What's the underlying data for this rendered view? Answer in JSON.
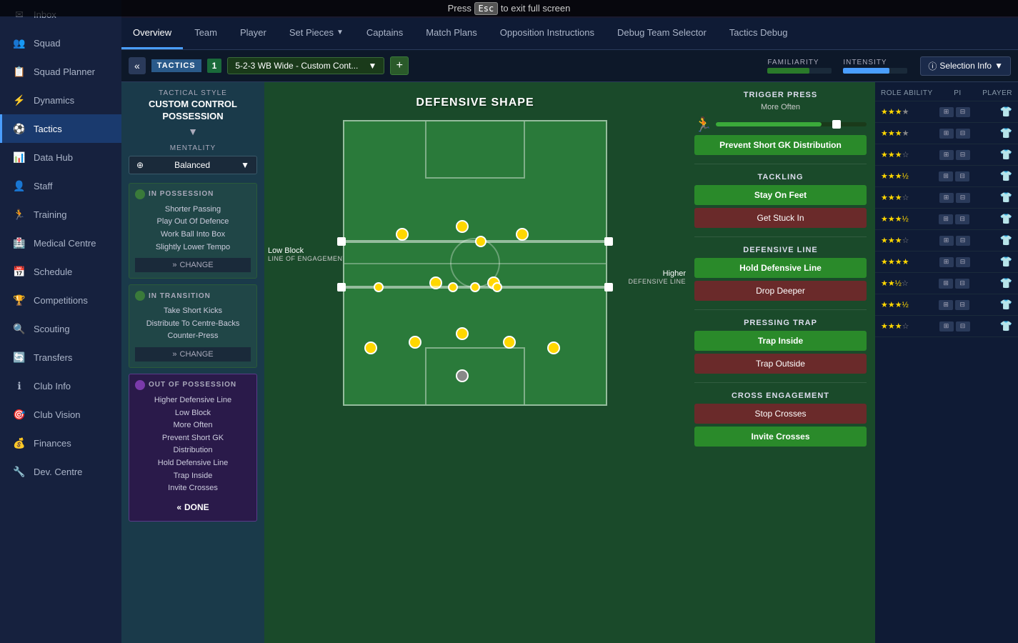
{
  "esc_bar": {
    "text_before": "Press",
    "key": "Esc",
    "text_after": "to exit full screen"
  },
  "sidebar": {
    "items": [
      {
        "id": "inbox",
        "label": "Inbox",
        "icon": "✉"
      },
      {
        "id": "squad",
        "label": "Squad",
        "icon": "👥"
      },
      {
        "id": "squad-planner",
        "label": "Squad Planner",
        "icon": "📋"
      },
      {
        "id": "dynamics",
        "label": "Dynamics",
        "icon": "⚡"
      },
      {
        "id": "tactics",
        "label": "Tactics",
        "icon": "⚽"
      },
      {
        "id": "data-hub",
        "label": "Data Hub",
        "icon": "📊"
      },
      {
        "id": "staff",
        "label": "Staff",
        "icon": "👤"
      },
      {
        "id": "training",
        "label": "Training",
        "icon": "🏃"
      },
      {
        "id": "medical",
        "label": "Medical Centre",
        "icon": "🏥"
      },
      {
        "id": "schedule",
        "label": "Schedule",
        "icon": "📅"
      },
      {
        "id": "competitions",
        "label": "Competitions",
        "icon": "🏆"
      },
      {
        "id": "scouting",
        "label": "Scouting",
        "icon": "🔍"
      },
      {
        "id": "transfers",
        "label": "Transfers",
        "icon": "🔄"
      },
      {
        "id": "club-info",
        "label": "Club Info",
        "icon": "ℹ"
      },
      {
        "id": "club-vision",
        "label": "Club Vision",
        "icon": "🎯"
      },
      {
        "id": "finances",
        "label": "Finances",
        "icon": "💰"
      },
      {
        "id": "dev-centre",
        "label": "Dev. Centre",
        "icon": "🔧"
      }
    ]
  },
  "top_nav": {
    "items": [
      {
        "id": "overview",
        "label": "Overview",
        "active": true
      },
      {
        "id": "team",
        "label": "Team",
        "active": false
      },
      {
        "id": "player",
        "label": "Player",
        "active": false
      },
      {
        "id": "set-pieces",
        "label": "Set Pieces",
        "has_dropdown": true,
        "active": false
      },
      {
        "id": "captains",
        "label": "Captains",
        "active": false
      },
      {
        "id": "match-plans",
        "label": "Match Plans",
        "active": false
      },
      {
        "id": "opp-instructions",
        "label": "Opposition Instructions",
        "active": false
      },
      {
        "id": "debug-team",
        "label": "Debug Team Selector",
        "active": false
      },
      {
        "id": "tactics-debug",
        "label": "Tactics Debug",
        "active": false
      }
    ]
  },
  "tactics_bar": {
    "tactics_label": "TACTICS",
    "tactic_num": "1",
    "formation": "5-2-3 WB Wide - Custom Cont...",
    "familiarity_label": "FAMILIARITY",
    "intensity_label": "INTENSITY",
    "familiarity_pct": 65,
    "intensity_pct": 72,
    "selection_info_label": "Selection Info"
  },
  "left_panel": {
    "tactical_style_label": "TACTICAL STYLE",
    "tactical_style_value": "CUSTOM CONTROL\nPOSSESSION",
    "mentality_label": "MENTALITY",
    "mentality_value": "Balanced",
    "in_possession_label": "IN POSSESSION",
    "in_possession_items": [
      "Shorter Passing",
      "Play Out Of Defence",
      "Work Ball Into Box",
      "Slightly Lower Tempo"
    ],
    "change_label": "CHANGE",
    "in_transition_label": "IN TRANSITION",
    "in_transition_items": [
      "Take Short Kicks",
      "Distribute To Centre-Backs",
      "Counter-Press"
    ],
    "out_of_possession_label": "OUT OF POSSESSION",
    "out_of_possession_items": [
      "Higher Defensive Line",
      "Low Block",
      "More Often",
      "Prevent Short GK Distribution",
      "Hold Defensive Line",
      "Trap Inside",
      "Invite Crosses"
    ],
    "done_label": "DONE"
  },
  "center_pitch": {
    "title": "DEFENSIVE SHAPE",
    "low_block_label": "Low Block",
    "line_of_engagement": "LINE OF ENGAGEMENT",
    "higher_defensive_line": "Higher\nDEFENSIVE LINE"
  },
  "right_panel": {
    "trigger_press_label": "TRIGGER PRESS",
    "trigger_more_often": "More Often",
    "prevent_short_gk": "Prevent Short GK Distribution",
    "tackling_label": "TACKLING",
    "stay_on_feet": "Stay On Feet",
    "get_stuck_in": "Get Stuck In",
    "defensive_line_label": "DEFENSIVE LINE",
    "hold_defensive_line": "Hold Defensive Line",
    "drop_deeper": "Drop Deeper",
    "pressing_trap_label": "PRESSING TRAP",
    "trap_inside": "Trap Inside",
    "trap_outside": "Trap Outside",
    "cross_engagement_label": "CROSS ENGAGEMENT",
    "stop_crosses": "Stop Crosses",
    "invite_crosses": "Invite Crosses"
  },
  "far_right": {
    "headers": [
      "ROLE ABILITY",
      "PI",
      "PLAYER"
    ],
    "rows": [
      {
        "stars": 3,
        "half": false
      },
      {
        "stars": 3,
        "half": false
      },
      {
        "stars": 3,
        "half": false
      },
      {
        "stars": 3.5,
        "half": true
      },
      {
        "stars": 3,
        "half": false
      },
      {
        "stars": 3.5,
        "half": true
      },
      {
        "stars": 3,
        "half": false
      },
      {
        "stars": 3.5,
        "half": true
      },
      {
        "stars": 3,
        "half": false
      },
      {
        "stars": 3.5,
        "half": true
      },
      {
        "stars": 3,
        "half": false
      }
    ]
  }
}
